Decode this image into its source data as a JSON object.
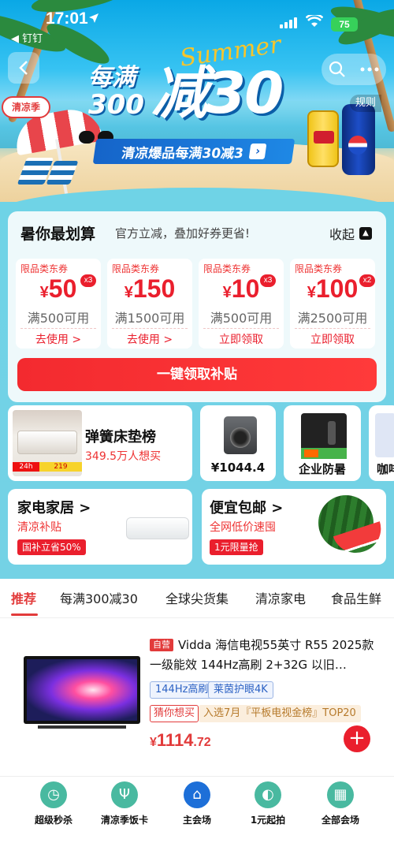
{
  "status_bar": {
    "time": "17:01",
    "back_app": "◀ 钉钉",
    "battery": "75"
  },
  "banner": {
    "summer": "Summer",
    "hero_line1": "每满",
    "hero_line2": "300",
    "hero_big": "减30",
    "promo": "清凉爆品每满30减3",
    "rules": "规则",
    "season_tag": "清凉季",
    "can_pepsi": "PEPSI",
    "can_redbull": "Red Bull"
  },
  "deals": {
    "title": "暑你最划算",
    "subtitle": "官方立减，叠加好券更省!",
    "collapse": "收起",
    "coupons": [
      {
        "tag": "限品类东券",
        "symbol": "¥",
        "amount": "50",
        "badge": "x3",
        "cond": "满500可用",
        "action": "去使用 >"
      },
      {
        "tag": "限品类东券",
        "symbol": "¥",
        "amount": "150",
        "badge": "",
        "cond": "满1500可用",
        "action": "去使用 >"
      },
      {
        "tag": "限品类东券",
        "symbol": "¥",
        "amount": "10",
        "badge": "x3",
        "cond": "满500可用",
        "action": "立即领取"
      },
      {
        "tag": "限品类东券",
        "symbol": "¥",
        "amount": "100",
        "badge": "x2",
        "cond": "满2500可用",
        "action": "立即领取"
      }
    ],
    "claim_all": "一键领取补贴"
  },
  "cards": {
    "mattress": {
      "title": "弹簧床垫榜",
      "sub": "349.5万人想买",
      "img_price": "219",
      "img_tag": "24h"
    },
    "washer": {
      "price": "¥1044.4"
    },
    "enterprise": {
      "title": "企业防暑"
    },
    "partial": {
      "title": "咖啡"
    },
    "appliance": {
      "title": "家电家居 >",
      "sub": "清凉补贴",
      "pill": "国补立省50%"
    },
    "cheap": {
      "title": "便宜包邮 >",
      "sub": "全网低价速囤",
      "pill": "1元限量抢"
    }
  },
  "tabs": [
    "推荐",
    "每满300减30",
    "全球尖货集",
    "清凉家电",
    "食品生鲜"
  ],
  "product": {
    "self_tag": "自营",
    "title": "Vidda 海信电视55英寸 R55 2025款 一级能效 144Hz高刷 2+32G 以旧…",
    "features": [
      "144Hz高刷",
      "莱茵护眼4K"
    ],
    "guess": "猜你想买",
    "rank": "入选7月『平板电视金榜』TOP20",
    "price_symbol": "¥",
    "price_int": "1114",
    "price_dec": ".72",
    "add": "+"
  },
  "bottom_nav": [
    {
      "label": "超级秒杀",
      "icon": "clock-icon",
      "glyph": "◷"
    },
    {
      "label": "清凉季饭卡",
      "icon": "fork-knife-icon",
      "glyph": "Ψ"
    },
    {
      "label": "主会场",
      "icon": "home-icon",
      "glyph": "⌂"
    },
    {
      "label": "1元起拍",
      "icon": "auction-icon",
      "glyph": "◐"
    },
    {
      "label": "全部会场",
      "icon": "grid-icon",
      "glyph": "▦"
    }
  ],
  "colors": {
    "accent_red": "#ea1f2d",
    "teal_bg": "#74d2e5",
    "promo_blue": "#1564c9",
    "home_blue": "#1d6fd8"
  }
}
